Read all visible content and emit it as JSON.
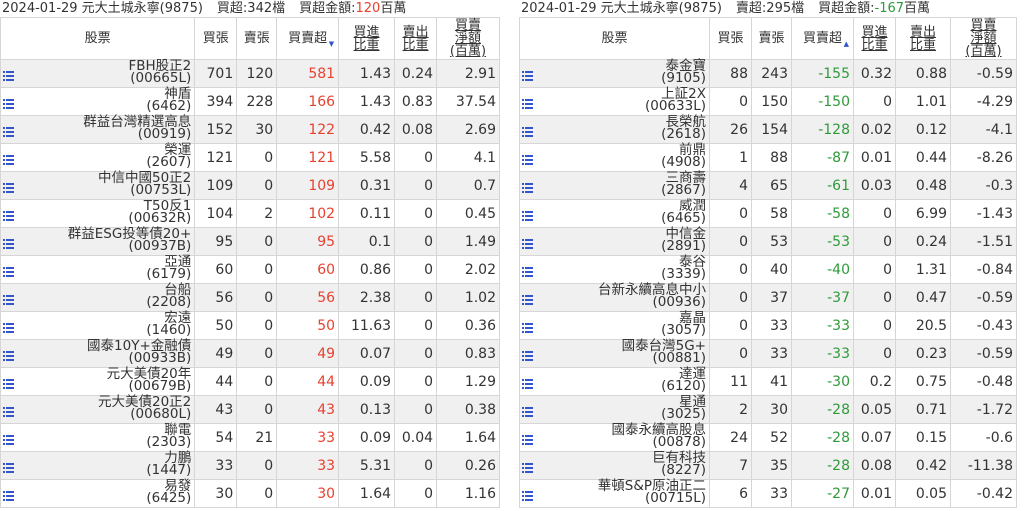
{
  "left": {
    "header": {
      "date_broker": "2024-01-29 元大土城永寧(9875)",
      "count_label": "買超:342檔",
      "amount_prefix": "買超金額:",
      "amount_value": "120",
      "amount_unit": "百萬"
    },
    "columns": [
      "股票",
      "買張",
      "賣張",
      "買賣超",
      "買進\n比重",
      "賣出\n比重",
      "買賣\n淨額\n(百萬)"
    ],
    "rows": [
      {
        "name": "FBH股正2",
        "code": "(00665L)",
        "buy": "701",
        "sell": "120",
        "net": "581",
        "buy_ratio": "1.43",
        "sell_ratio": "0.24",
        "amount": "2.91"
      },
      {
        "name": "神盾",
        "code": "(6462)",
        "buy": "394",
        "sell": "228",
        "net": "166",
        "buy_ratio": "1.43",
        "sell_ratio": "0.83",
        "amount": "37.54"
      },
      {
        "name": "群益台灣精選高息",
        "code": "(00919)",
        "buy": "152",
        "sell": "30",
        "net": "122",
        "buy_ratio": "0.42",
        "sell_ratio": "0.08",
        "amount": "2.69"
      },
      {
        "name": "榮運",
        "code": "(2607)",
        "buy": "121",
        "sell": "0",
        "net": "121",
        "buy_ratio": "5.58",
        "sell_ratio": "0",
        "amount": "4.1"
      },
      {
        "name": "中信中國50正2",
        "code": "(00753L)",
        "buy": "109",
        "sell": "0",
        "net": "109",
        "buy_ratio": "0.31",
        "sell_ratio": "0",
        "amount": "0.7"
      },
      {
        "name": "T50反1",
        "code": "(00632R)",
        "buy": "104",
        "sell": "2",
        "net": "102",
        "buy_ratio": "0.11",
        "sell_ratio": "0",
        "amount": "0.45"
      },
      {
        "name": "群益ESG投等債20+",
        "code": "(00937B)",
        "buy": "95",
        "sell": "0",
        "net": "95",
        "buy_ratio": "0.1",
        "sell_ratio": "0",
        "amount": "1.49"
      },
      {
        "name": "亞通",
        "code": "(6179)",
        "buy": "60",
        "sell": "0",
        "net": "60",
        "buy_ratio": "0.86",
        "sell_ratio": "0",
        "amount": "2.02"
      },
      {
        "name": "台船",
        "code": "(2208)",
        "buy": "56",
        "sell": "0",
        "net": "56",
        "buy_ratio": "2.38",
        "sell_ratio": "0",
        "amount": "1.02"
      },
      {
        "name": "宏遠",
        "code": "(1460)",
        "buy": "50",
        "sell": "0",
        "net": "50",
        "buy_ratio": "11.63",
        "sell_ratio": "0",
        "amount": "0.36"
      },
      {
        "name": "國泰10Y+金融債",
        "code": "(00933B)",
        "buy": "49",
        "sell": "0",
        "net": "49",
        "buy_ratio": "0.07",
        "sell_ratio": "0",
        "amount": "0.83"
      },
      {
        "name": "元大美債20年",
        "code": "(00679B)",
        "buy": "44",
        "sell": "0",
        "net": "44",
        "buy_ratio": "0.09",
        "sell_ratio": "0",
        "amount": "1.29"
      },
      {
        "name": "元大美債20正2",
        "code": "(00680L)",
        "buy": "43",
        "sell": "0",
        "net": "43",
        "buy_ratio": "0.13",
        "sell_ratio": "0",
        "amount": "0.38"
      },
      {
        "name": "聯電",
        "code": "(2303)",
        "buy": "54",
        "sell": "21",
        "net": "33",
        "buy_ratio": "0.09",
        "sell_ratio": "0.04",
        "amount": "1.64"
      },
      {
        "name": "力鵬",
        "code": "(1447)",
        "buy": "33",
        "sell": "0",
        "net": "33",
        "buy_ratio": "5.31",
        "sell_ratio": "0",
        "amount": "0.26"
      },
      {
        "name": "易發",
        "code": "(6425)",
        "buy": "30",
        "sell": "0",
        "net": "30",
        "buy_ratio": "1.64",
        "sell_ratio": "0",
        "amount": "1.16"
      }
    ]
  },
  "right": {
    "header": {
      "date_broker": "2024-01-29 元大土城永寧(9875)",
      "count_label": "賣超:295檔",
      "amount_prefix": "買超金額:",
      "amount_value": "-167",
      "amount_unit": "百萬"
    },
    "columns": [
      "股票",
      "買張",
      "賣張",
      "買賣超",
      "買進\n比重",
      "賣出\n比重",
      "買賣\n淨額\n(百萬)"
    ],
    "rows": [
      {
        "name": "泰金寶",
        "code": "(9105)",
        "buy": "88",
        "sell": "243",
        "net": "-155",
        "buy_ratio": "0.32",
        "sell_ratio": "0.88",
        "amount": "-0.59"
      },
      {
        "name": "上証2X",
        "code": "(00633L)",
        "buy": "0",
        "sell": "150",
        "net": "-150",
        "buy_ratio": "0",
        "sell_ratio": "1.01",
        "amount": "-4.29"
      },
      {
        "name": "長榮航",
        "code": "(2618)",
        "buy": "26",
        "sell": "154",
        "net": "-128",
        "buy_ratio": "0.02",
        "sell_ratio": "0.12",
        "amount": "-4.1"
      },
      {
        "name": "前鼎",
        "code": "(4908)",
        "buy": "1",
        "sell": "88",
        "net": "-87",
        "buy_ratio": "0.01",
        "sell_ratio": "0.44",
        "amount": "-8.26"
      },
      {
        "name": "三商壽",
        "code": "(2867)",
        "buy": "4",
        "sell": "65",
        "net": "-61",
        "buy_ratio": "0.03",
        "sell_ratio": "0.48",
        "amount": "-0.3"
      },
      {
        "name": "威潤",
        "code": "(6465)",
        "buy": "0",
        "sell": "58",
        "net": "-58",
        "buy_ratio": "0",
        "sell_ratio": "6.99",
        "amount": "-1.43"
      },
      {
        "name": "中信金",
        "code": "(2891)",
        "buy": "0",
        "sell": "53",
        "net": "-53",
        "buy_ratio": "0",
        "sell_ratio": "0.24",
        "amount": "-1.51"
      },
      {
        "name": "泰谷",
        "code": "(3339)",
        "buy": "0",
        "sell": "40",
        "net": "-40",
        "buy_ratio": "0",
        "sell_ratio": "1.31",
        "amount": "-0.84"
      },
      {
        "name": "台新永續高息中小",
        "code": "(00936)",
        "buy": "0",
        "sell": "37",
        "net": "-37",
        "buy_ratio": "0",
        "sell_ratio": "0.47",
        "amount": "-0.59"
      },
      {
        "name": "嘉晶",
        "code": "(3057)",
        "buy": "0",
        "sell": "33",
        "net": "-33",
        "buy_ratio": "0",
        "sell_ratio": "20.5",
        "amount": "-0.43"
      },
      {
        "name": "國泰台灣5G+",
        "code": "(00881)",
        "buy": "0",
        "sell": "33",
        "net": "-33",
        "buy_ratio": "0",
        "sell_ratio": "0.23",
        "amount": "-0.59"
      },
      {
        "name": "達運",
        "code": "(6120)",
        "buy": "11",
        "sell": "41",
        "net": "-30",
        "buy_ratio": "0.2",
        "sell_ratio": "0.75",
        "amount": "-0.48"
      },
      {
        "name": "星通",
        "code": "(3025)",
        "buy": "2",
        "sell": "30",
        "net": "-28",
        "buy_ratio": "0.05",
        "sell_ratio": "0.71",
        "amount": "-1.72"
      },
      {
        "name": "國泰永續高股息",
        "code": "(00878)",
        "buy": "24",
        "sell": "52",
        "net": "-28",
        "buy_ratio": "0.07",
        "sell_ratio": "0.15",
        "amount": "-0.6"
      },
      {
        "name": "巨有科技",
        "code": "(8227)",
        "buy": "7",
        "sell": "35",
        "net": "-28",
        "buy_ratio": "0.08",
        "sell_ratio": "0.42",
        "amount": "-11.38"
      },
      {
        "name": "華頓S&P原油正二",
        "code": "(00715L)",
        "buy": "6",
        "sell": "33",
        "net": "-27",
        "buy_ratio": "0.01",
        "sell_ratio": "0.05",
        "amount": "-0.42"
      }
    ]
  },
  "icons": {
    "row_menu": "list-icon",
    "sort": "sort-desc-icon"
  },
  "colors": {
    "positive": "#e8412f",
    "negative": "#2f9a3a",
    "row_alt": "#f0f0f0",
    "icon": "#3355cc"
  }
}
